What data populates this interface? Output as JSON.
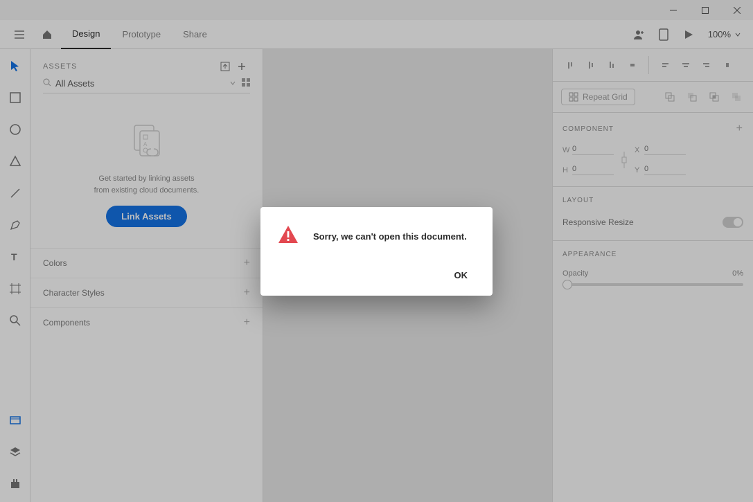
{
  "window": {
    "minimize_name": "minimize",
    "maximize_name": "maximize",
    "close_name": "close"
  },
  "tabs": {
    "design": "Design",
    "prototype": "Prototype",
    "share": "Share",
    "zoom": "100%"
  },
  "tools": {
    "select": "select",
    "rectangle": "rectangle",
    "ellipse": "ellipse",
    "polygon": "polygon",
    "line": "line",
    "pen": "pen",
    "text": "text",
    "artboard": "artboard",
    "zoom": "zoom",
    "assets": "assets",
    "layers": "layers",
    "plugins": "plugins"
  },
  "assets_panel": {
    "title": "ASSETS",
    "filter_label": "All Assets",
    "empty_line1": "Get started by linking assets",
    "empty_line2": "from existing cloud documents.",
    "link_button": "Link Assets",
    "sections": {
      "colors": "Colors",
      "char_styles": "Character Styles",
      "components": "Components"
    }
  },
  "inspector": {
    "repeat_grid": "Repeat Grid",
    "component_h": "COMPONENT",
    "w_label": "W",
    "h_label": "H",
    "x_label": "X",
    "y_label": "Y",
    "w_val": "0",
    "h_val": "0",
    "x_val": "0",
    "y_val": "0",
    "layout_h": "LAYOUT",
    "responsive": "Responsive Resize",
    "appearance_h": "APPEARANCE",
    "opacity_label": "Opacity",
    "opacity_value": "0%"
  },
  "dialog": {
    "message": "Sorry, we can't open this document.",
    "ok": "OK"
  }
}
